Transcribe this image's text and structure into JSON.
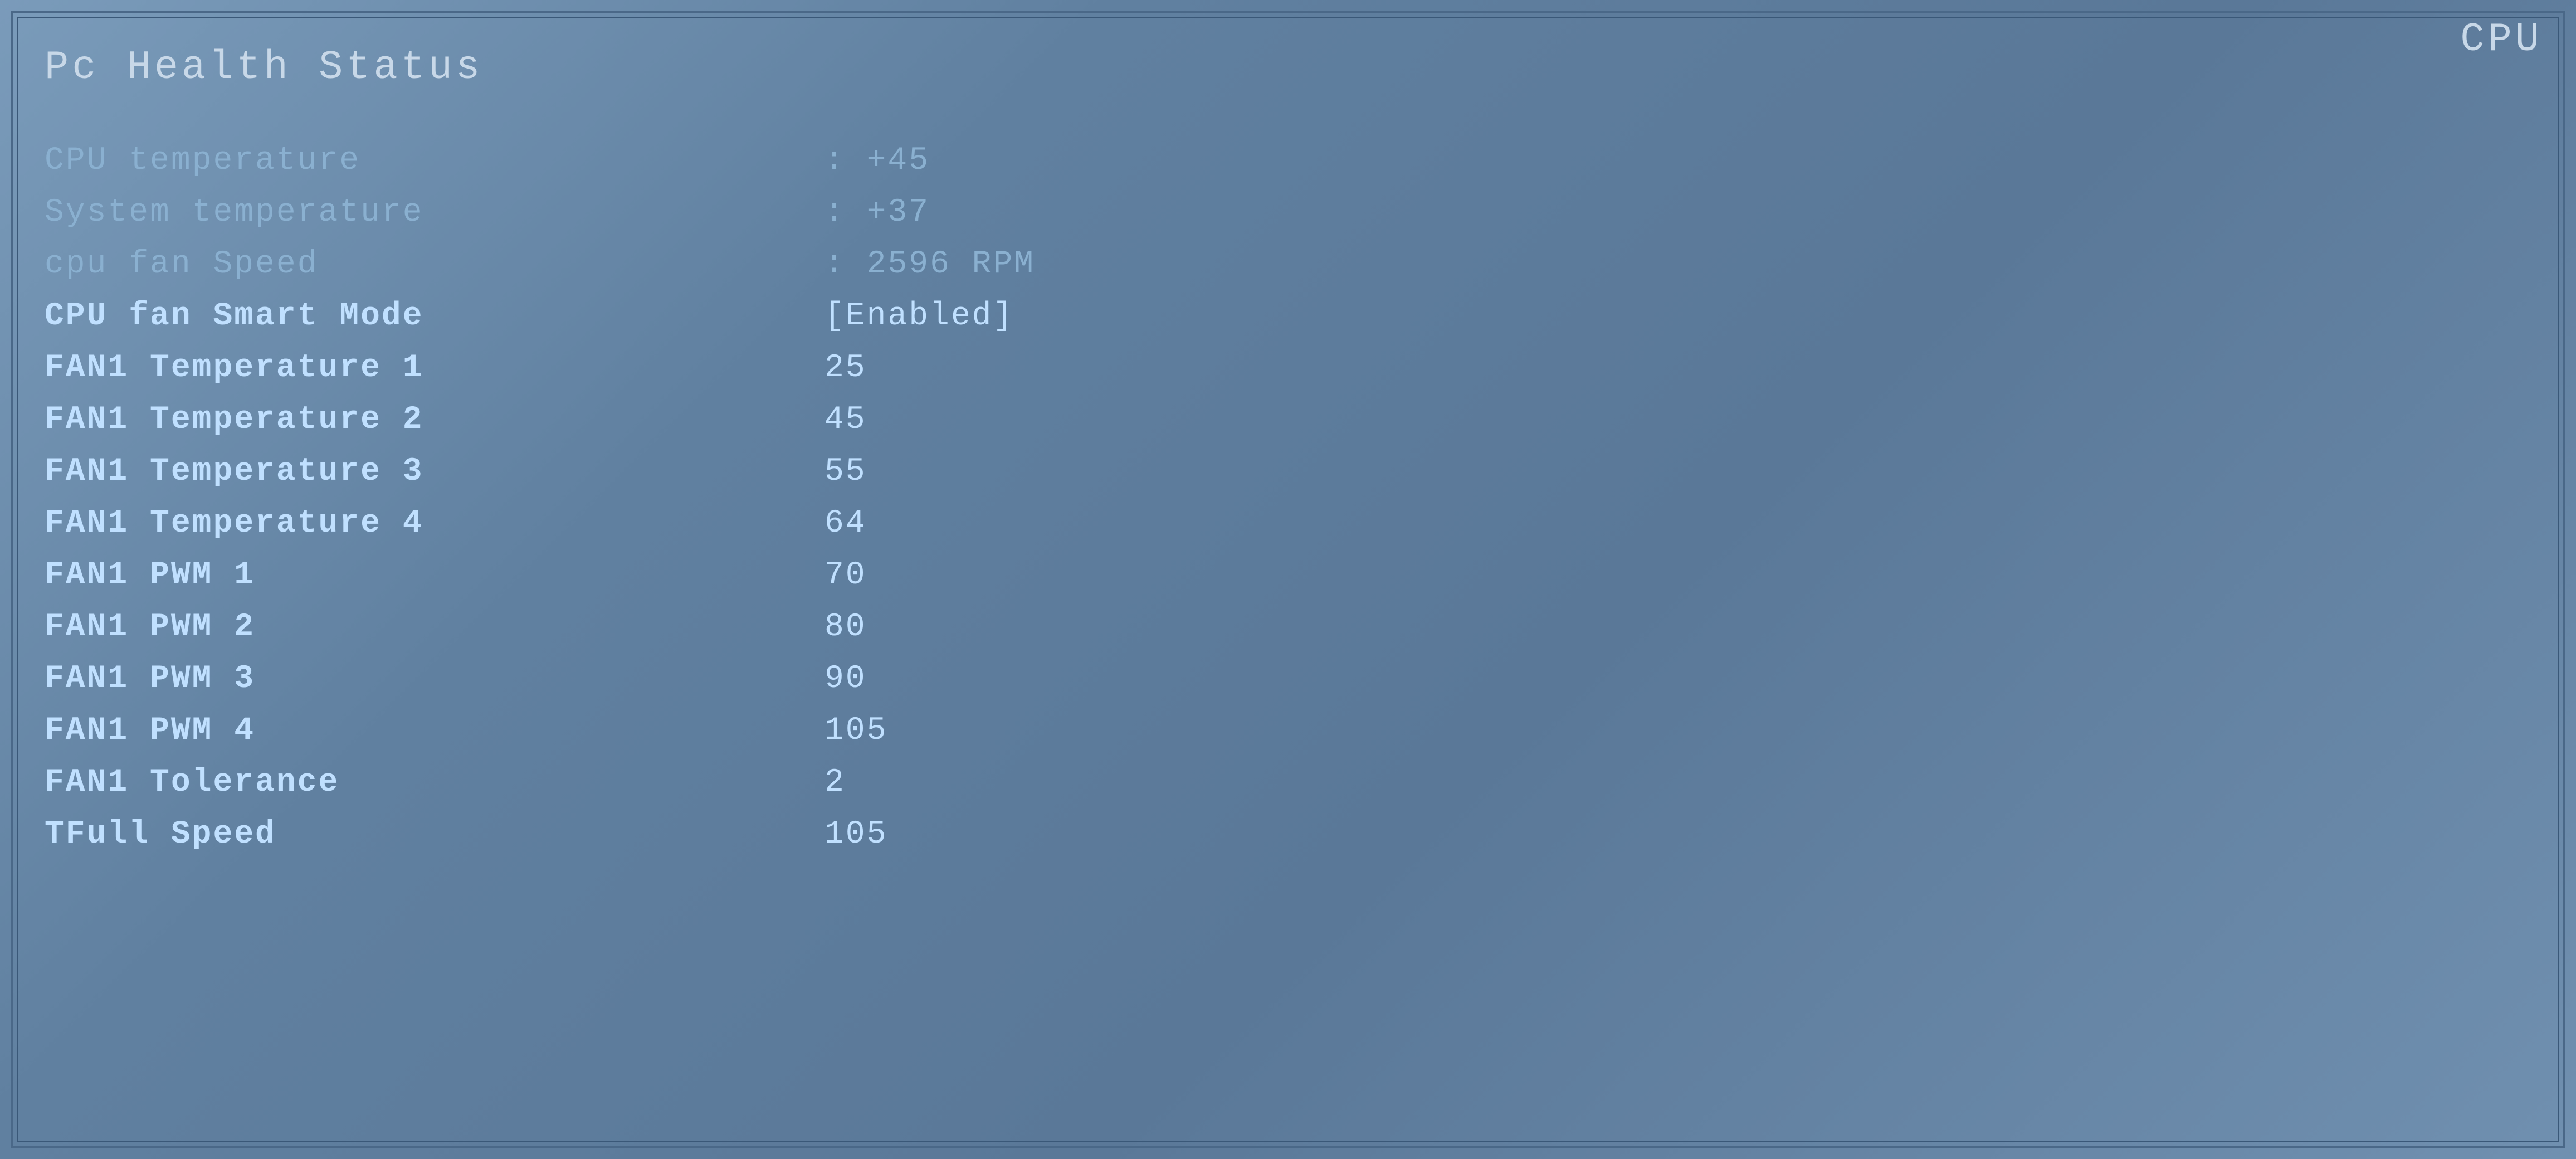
{
  "page": {
    "title": "Pc Health Status",
    "top_right": "CPU",
    "background_color": "#6e8fad"
  },
  "settings": [
    {
      "label": "CPU temperature",
      "value": ": +45",
      "highlighted": false,
      "bracketed": false
    },
    {
      "label": "System temperature",
      "value": ": +37",
      "highlighted": false,
      "bracketed": false
    },
    {
      "label": "cpu fan Speed",
      "value": ": 2596 RPM",
      "highlighted": false,
      "bracketed": false
    },
    {
      "label": "CPU fan Smart Mode",
      "value": "[Enabled]",
      "highlighted": true,
      "bracketed": true
    },
    {
      "label": "FAN1 Temperature 1",
      "value": "25",
      "highlighted": true,
      "bracketed": false
    },
    {
      "label": "FAN1 Temperature 2",
      "value": "45",
      "highlighted": true,
      "bracketed": false
    },
    {
      "label": "FAN1 Temperature 3",
      "value": "55",
      "highlighted": true,
      "bracketed": false
    },
    {
      "label": "FAN1 Temperature 4",
      "value": "64",
      "highlighted": true,
      "bracketed": false
    },
    {
      "label": "FAN1 PWM 1",
      "value": "70",
      "highlighted": true,
      "bracketed": false
    },
    {
      "label": "FAN1 PWM 2",
      "value": "80",
      "highlighted": true,
      "bracketed": false
    },
    {
      "label": "FAN1 PWM 3",
      "value": "90",
      "highlighted": true,
      "bracketed": false
    },
    {
      "label": "FAN1 PWM 4",
      "value": "105",
      "highlighted": true,
      "bracketed": false
    },
    {
      "label": "FAN1 Tolerance",
      "value": "2",
      "highlighted": true,
      "bracketed": false
    },
    {
      "label": "TFull Speed",
      "value": "105",
      "highlighted": true,
      "bracketed": false
    }
  ]
}
